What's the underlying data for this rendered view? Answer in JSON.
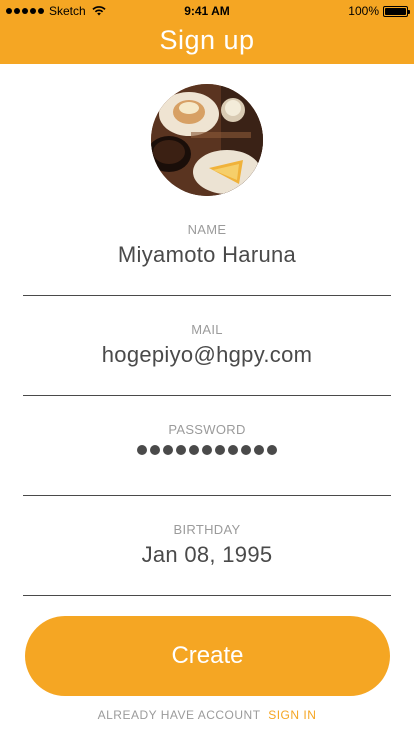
{
  "status_bar": {
    "carrier": "Sketch",
    "time": "9:41 AM",
    "battery": "100%",
    "signal_icon": "signal-dots-icon",
    "wifi_icon": "wifi-icon",
    "battery_icon": "battery-icon"
  },
  "nav": {
    "title": "Sign up"
  },
  "avatar": {
    "icon": "profile-photo"
  },
  "form": {
    "name": {
      "label": "NAME",
      "value": "Miyamoto Haruna"
    },
    "mail": {
      "label": "MAIL",
      "value": "hogepiyo@hgpy.com"
    },
    "password": {
      "label": "PASSWORD",
      "masked_length": 11
    },
    "birthday": {
      "label": "BIRTHDAY",
      "value": "Jan 08, 1995"
    }
  },
  "actions": {
    "create_label": "Create"
  },
  "footer": {
    "prompt": "ALREADY HAVE ACCOUNT",
    "sign_in_label": "SIGN IN"
  },
  "colors": {
    "accent": "#F5A623",
    "text": "#4A4A4A",
    "muted": "#9B9B9B",
    "background": "#FFFFFF"
  }
}
